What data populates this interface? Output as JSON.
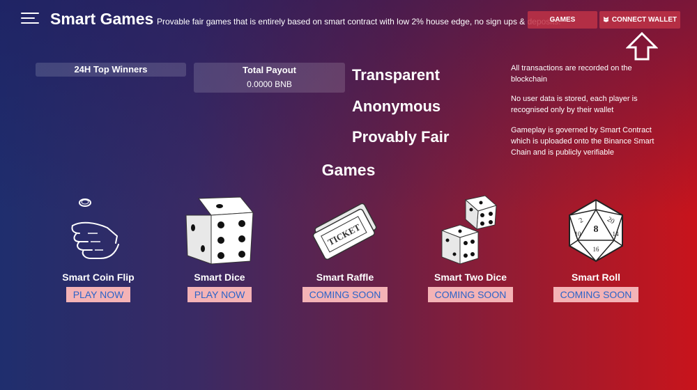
{
  "header": {
    "brand": "Smart Games",
    "tagline": "Provable fair games that is entirely based on smart contract with low 2% house edge, no sign ups & deposits.",
    "games_button": "GAMES",
    "connect_wallet_button": "CONNECT WALLET",
    "menu_icon": "hamburger-icon",
    "wallet_icon": "metamask-fox-icon"
  },
  "stats": {
    "winners_title": "24H Top Winners",
    "payout_title": "Total Payout",
    "payout_value": "0.0000 BNB"
  },
  "features": [
    "Transparent",
    "Anonymous",
    "Provably Fair"
  ],
  "info": [
    "All transactions are recorded on the blockchain",
    "No user data is stored, each player is recognised only by their wallet",
    "Gameplay is governed by Smart Contract which is uploaded onto the Binance Smart Chain and is publicly verifiable"
  ],
  "games_section_title": "Games",
  "games": [
    {
      "name": "Smart Coin Flip",
      "button": "PLAY NOW",
      "icon": "coin-flip-icon"
    },
    {
      "name": "Smart Dice",
      "button": "PLAY NOW",
      "icon": "dice-icon"
    },
    {
      "name": "Smart Raffle",
      "button": "COMING SOON",
      "icon": "ticket-icon"
    },
    {
      "name": "Smart Two Dice",
      "button": "COMING SOON",
      "icon": "two-dice-icon"
    },
    {
      "name": "Smart Roll",
      "button": "COMING SOON",
      "icon": "d20-icon"
    }
  ],
  "colors": {
    "button_bg": "#f4b3b6",
    "button_text": "#2b63c8",
    "top_button_bg": "#be3246",
    "gradient_left": "#1f2e6e",
    "gradient_right": "#c8141c"
  }
}
